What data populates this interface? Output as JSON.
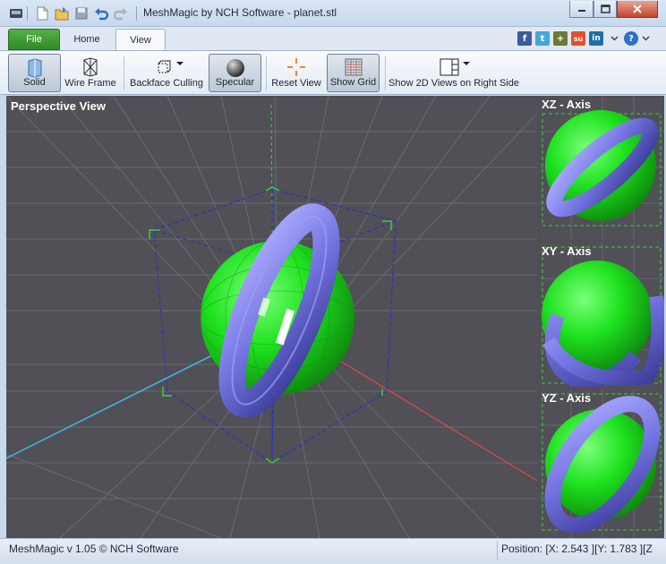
{
  "window": {
    "title": "MeshMagic by NCH Software - planet.stl",
    "minimize_icon": "minimize-icon",
    "maximize_icon": "maximize-icon",
    "close_icon": "close-icon"
  },
  "quick_access": [
    "app-menu-icon",
    "new-file-icon",
    "open-file-icon",
    "save-icon",
    "undo-icon",
    "redo-icon"
  ],
  "tabs": [
    {
      "label": "File"
    },
    {
      "label": "Home"
    },
    {
      "label": "View",
      "active": true
    }
  ],
  "social": {
    "facebook": "f",
    "twitter": "t",
    "google": "+",
    "stumbleupon": "su",
    "linkedin": "in",
    "help": "?"
  },
  "toolbar": {
    "solid_label": "Solid",
    "wireframe_label": "Wire Frame",
    "backface_label": "Backface Culling",
    "specular_label": "Specular",
    "reset_view_label": "Reset View",
    "show_grid_label": "Show Grid",
    "show_2d_label": "Show 2D Views on Right Side"
  },
  "viewports": {
    "perspective_label": "Perspective View",
    "xz_label": "XZ - Axis",
    "xy_label": "XY - Axis",
    "yz_label": "YZ - Axis"
  },
  "status": {
    "left": "MeshMagic v 1.05 © NCH Software",
    "right": "Position: [X: 2.543 ][Y: 1.783 ][Z"
  },
  "colors": {
    "sphere": "#22d622",
    "ring": "#7b7be6",
    "viewport_bg": "#505056",
    "file_tab": "#3e9a35"
  }
}
